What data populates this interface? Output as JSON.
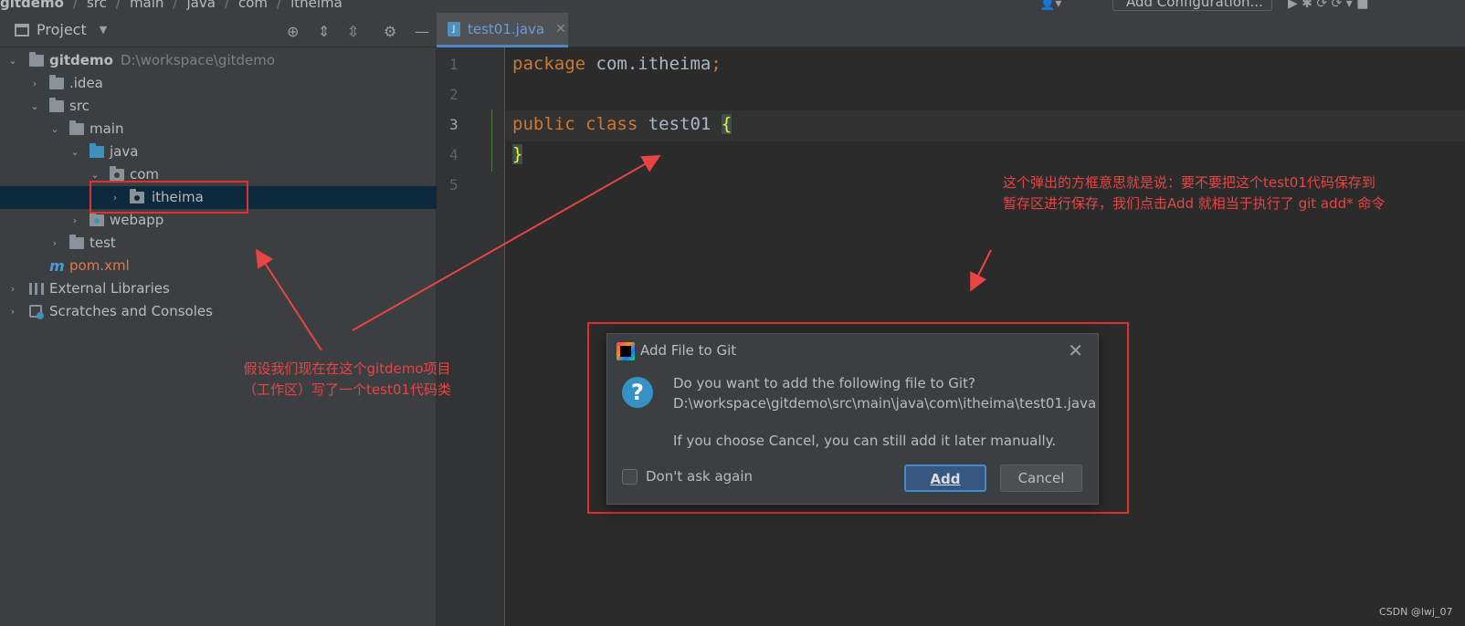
{
  "breadcrumb": [
    "gitdemo",
    "src",
    "main",
    "java",
    "com",
    "itheima"
  ],
  "toolbar": {
    "add_configuration": "Add Configuration..."
  },
  "project_panel": {
    "title": "Project",
    "tree": [
      {
        "label": "gitdemo",
        "path": "D:\\workspace\\gitdemo"
      },
      {
        "label": ".idea"
      },
      {
        "label": "src"
      },
      {
        "label": "main"
      },
      {
        "label": "java"
      },
      {
        "label": "com"
      },
      {
        "label": "itheima"
      },
      {
        "label": "webapp"
      },
      {
        "label": "test"
      },
      {
        "label": "pom.xml",
        "icon": "m"
      },
      {
        "label": "External Libraries"
      },
      {
        "label": "Scratches and Consoles"
      }
    ]
  },
  "editor": {
    "tab": "test01.java",
    "line_numbers": [
      "1",
      "2",
      "3",
      "4",
      "5"
    ],
    "code": {
      "l1_kw": "package",
      "l1_rest": " com.itheima",
      "l1_semi": ";",
      "l3_kw": "public class",
      "l3_id": " test01 ",
      "l3_brace": "{",
      "l4_brace": "}"
    }
  },
  "dialog": {
    "title": "Add File to Git",
    "question": "Do you want to add the following file to Git?",
    "file_path": "D:\\workspace\\gitdemo\\src\\main\\java\\com\\itheima\\test01.java",
    "hint": "If you choose Cancel, you can still add it later manually.",
    "checkbox_label": "Don't ask again",
    "add_button": "Add",
    "cancel_button": "Cancel"
  },
  "annotations": {
    "left_line1": "假设我们现在在这个gitdemo项目",
    "left_line2": "（工作区）写了一个test01代码类",
    "right_line1": "这个弹出的方框意思就是说：要不要把这个test01代码保存到",
    "right_line2": "暂存区进行保存，我们点击Add 就相当于执行了 git add* 命令"
  },
  "watermark": "CSDN @lwj_07",
  "colors": {
    "annotation_red": "#e84444",
    "keyword": "#cc7832",
    "selection": "#0d293e"
  }
}
